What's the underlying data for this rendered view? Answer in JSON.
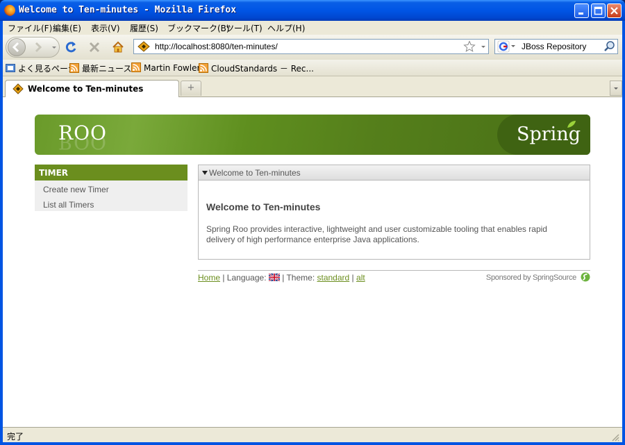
{
  "window": {
    "title": "Welcome to Ten-minutes - Mozilla Firefox"
  },
  "menu": {
    "items": [
      "ファイル(F)",
      "編集(E)",
      "表示(V)",
      "履歴(S)",
      "ブックマーク(B)",
      "ツール(T)",
      "ヘルプ(H)"
    ]
  },
  "navigation": {
    "url": "http://localhost:8080/ten-minutes/",
    "search_text": "JBoss Repository"
  },
  "bookmarks": {
    "items": [
      "よく見るページ",
      "最新ニュース",
      "Martin Fowler",
      "CloudStandards － Rec..."
    ]
  },
  "tabs": {
    "active_label": "Welcome to Ten-minutes",
    "new_tab_symbol": "+"
  },
  "page": {
    "banner": {
      "left_logo": "ROO",
      "right_logo": "Spring"
    },
    "sidebar": {
      "heading": "TIMER",
      "items": [
        "Create new Timer",
        "List all Timers"
      ]
    },
    "panel": {
      "header": "Welcome to Ten-minutes",
      "heading": "Welcome to Ten-minutes",
      "body": "Spring Roo provides interactive, lightweight and user customizable tooling that enables rapid delivery of high performance enterprise Java applications."
    },
    "footer": {
      "home": "Home",
      "language_label": "| Language:",
      "theme_label": "| Theme:",
      "theme_standard": "standard",
      "separator": "|",
      "theme_alt": "alt",
      "sponsor": "Sponsored by SpringSource"
    }
  },
  "status": {
    "text": "完了"
  },
  "colors": {
    "accent": "#6b8e1e",
    "titlebar": "#0055e5",
    "link": "#6b8e1e"
  },
  "icons": [
    "firefox-icon",
    "back-icon",
    "forward-icon",
    "reload-icon",
    "stop-icon",
    "home-icon",
    "bookmark-star-icon",
    "google-icon",
    "search-icon",
    "rss-icon",
    "flag-uk-icon",
    "springsource-icon"
  ]
}
